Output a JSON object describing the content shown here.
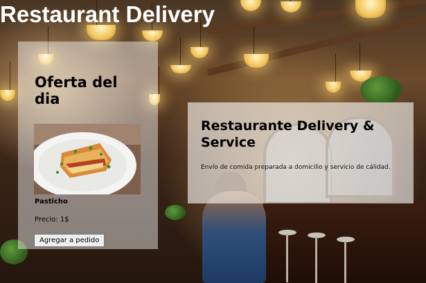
{
  "header": {
    "title": "Restaurant Delivery"
  },
  "offer": {
    "title": "Oferta del dia",
    "dish_name": "Pasticho",
    "price": "Precio: 1$",
    "add_button_label": "Agregar a pedido"
  },
  "service": {
    "title": "Restaurante Delivery & Service",
    "description": "Envío de comida preparada a domicilio y servicio de cálidad."
  },
  "colors": {
    "title_text": "#ffffff",
    "card_overlay": "#ffffff"
  }
}
